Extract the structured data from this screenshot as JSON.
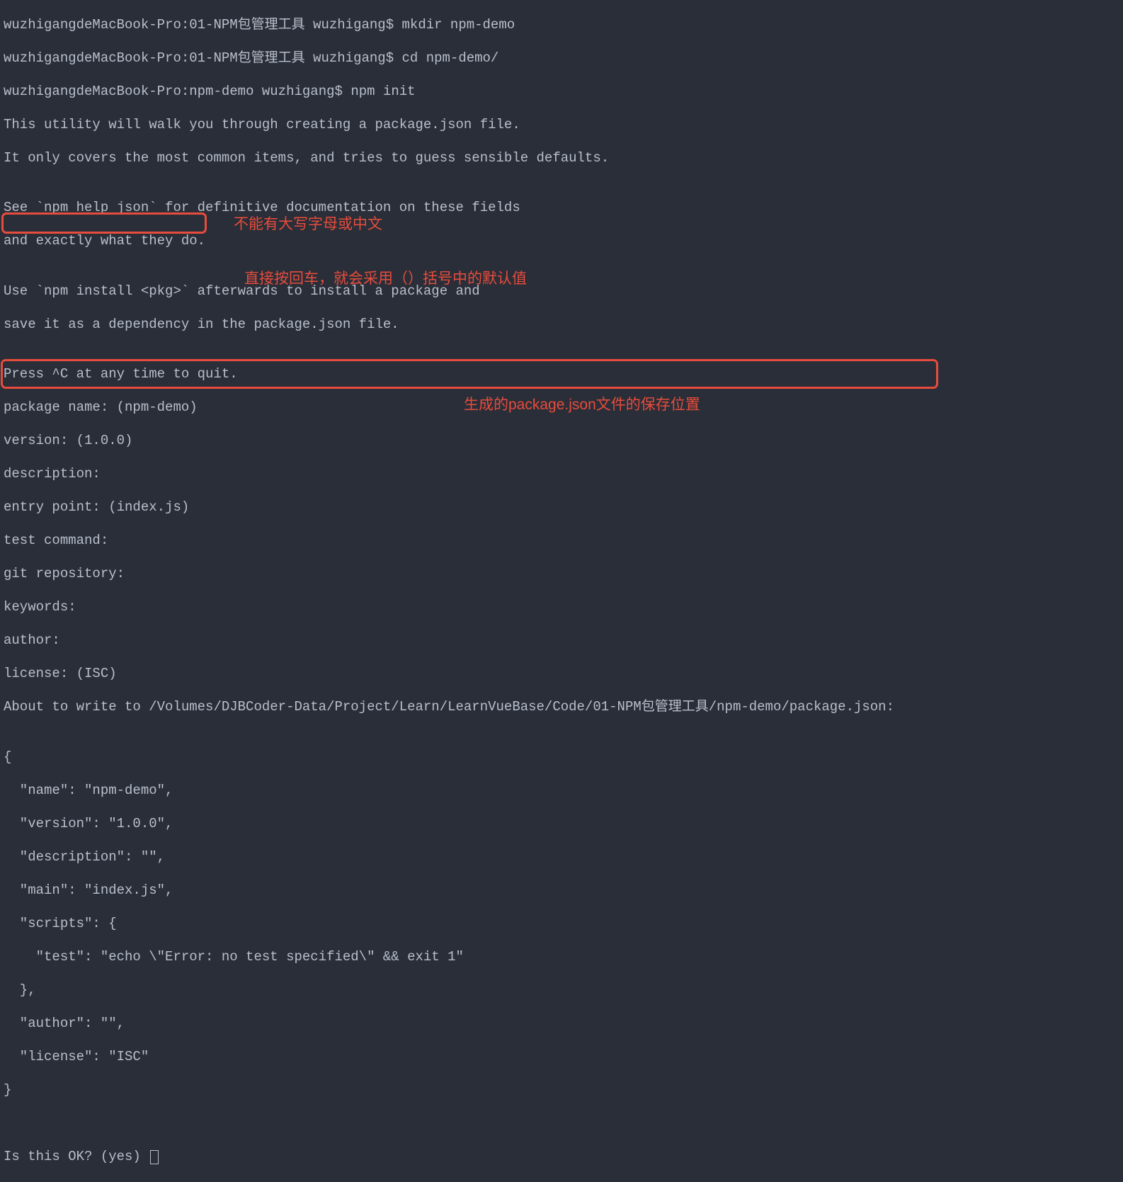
{
  "prompt1": {
    "host": "wuzhigangdeMacBook-Pro",
    "dir": "01-NPM包管理工具",
    "user": "wuzhigang",
    "cmd": "mkdir npm-demo"
  },
  "prompt2": {
    "host": "wuzhigangdeMacBook-Pro",
    "dir": "01-NPM包管理工具",
    "user": "wuzhigang",
    "cmd": "cd npm-demo/"
  },
  "prompt3": {
    "host": "wuzhigangdeMacBook-Pro",
    "dir": "npm-demo",
    "user": "wuzhigang",
    "cmd": "npm init"
  },
  "out": {
    "l1": "This utility will walk you through creating a package.json file.",
    "l2": "It only covers the most common items, and tries to guess sensible defaults.",
    "l3": "",
    "l4": "See `npm help json` for definitive documentation on these fields",
    "l5": "and exactly what they do.",
    "l6": "",
    "l7": "Use `npm install <pkg>` afterwards to install a package and",
    "l8": "save it as a dependency in the package.json file.",
    "l9": "",
    "l10": "Press ^C at any time to quit.",
    "l11": "package name: (npm-demo) ",
    "l12": "version: (1.0.0) ",
    "l13": "description: ",
    "l14": "entry point: (index.js) ",
    "l15": "test command: ",
    "l16": "git repository: ",
    "l17": "keywords: ",
    "l18": "author: ",
    "l19": "license: (ISC) ",
    "l20": "About to write to /Volumes/DJBCoder-Data/Project/Learn/LearnVueBase/Code/01-NPM包管理工具/npm-demo/package.json:",
    "l21": "",
    "l22": "{",
    "l23": "  \"name\": \"npm-demo\",",
    "l24": "  \"version\": \"1.0.0\",",
    "l25": "  \"description\": \"\",",
    "l26": "  \"main\": \"index.js\",",
    "l27": "  \"scripts\": {",
    "l28": "    \"test\": \"echo \\\"Error: no test specified\\\" && exit 1\"",
    "l29": "  },",
    "l30": "  \"author\": \"\",",
    "l31": "  \"license\": \"ISC\"",
    "l32": "}",
    "l33": "",
    "l34": "",
    "l35_prefix": "Is this OK? (yes) "
  },
  "annotations": {
    "a1": "不能有大写字母或中文",
    "a2": "直接按回车，就会采用（）括号中的默认值",
    "a3": "生成的package.json文件的保存位置"
  }
}
